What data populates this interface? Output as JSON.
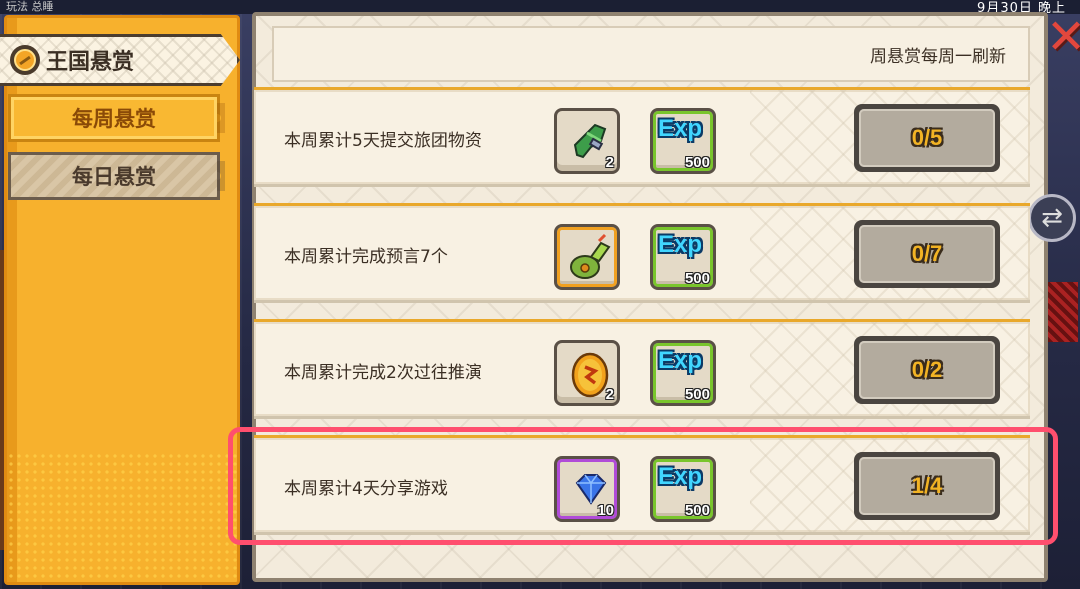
{
  "top_bar": {
    "left_text": "玩法  总睡",
    "date_text": "9月30日  晚上"
  },
  "sidebar": {
    "title": "王国悬赏",
    "tabs": [
      {
        "label": "每周悬赏",
        "selected": true
      },
      {
        "label": "每日悬赏",
        "selected": false
      }
    ]
  },
  "header": {
    "refresh_note": "周悬赏每周一刷新"
  },
  "close_label": "✕",
  "tasks": [
    {
      "name": "本周累计5天提交旅团物资",
      "item_icon": "green-herb-icon",
      "item_qty": "2",
      "exp_label": "Exp",
      "exp_qty": "500",
      "progress": "0/5",
      "highlighted": false
    },
    {
      "name": "本周累计完成预言7个",
      "item_icon": "green-pouch-icon",
      "item_qty": "",
      "exp_label": "Exp",
      "exp_qty": "500",
      "progress": "0/7",
      "highlighted": false
    },
    {
      "name": "本周累计完成2次过往推演",
      "item_icon": "golden-egg-icon",
      "item_qty": "2",
      "exp_label": "Exp",
      "exp_qty": "500",
      "progress": "0/2",
      "highlighted": false
    },
    {
      "name": "本周累计4天分享游戏",
      "item_icon": "blue-gem-icon",
      "item_qty": "10",
      "exp_label": "Exp",
      "exp_qty": "500",
      "progress": "1/4",
      "highlighted": true
    }
  ],
  "colors": {
    "sidebar": "#f7b12d",
    "panel": "#f3ebdc",
    "highlight": "#ff4f6e",
    "progress_text": "#f2b324",
    "exp_text": "#41d6ff"
  }
}
